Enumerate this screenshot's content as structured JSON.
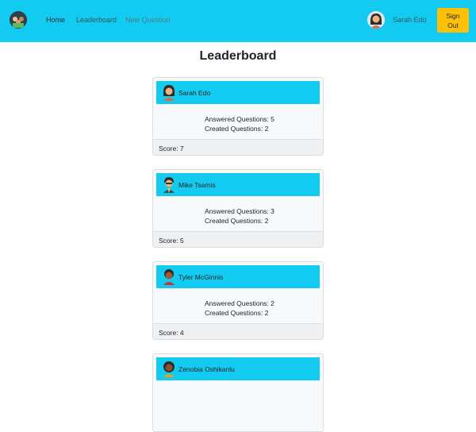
{
  "nav": {
    "home": "Home",
    "leaderboard": "Leaderboard",
    "new_question": "New Question",
    "user_name": "Sarah Edo",
    "sign_out": "Sign\nOut"
  },
  "page_title": "Leaderboard",
  "colors": {
    "navbar": "#13cbf0",
    "card_header": "#13cbf0",
    "sign_out": "#ffc107"
  },
  "users": [
    {
      "name": "Sarah Edo",
      "answered": "Answered Questions: 5",
      "created": "Created Questions: 2",
      "score": "Score: 7",
      "avatar": "woman-avatar-icon"
    },
    {
      "name": "Mike Tsamis",
      "answered": "Answered Questions: 3",
      "created": "Created Questions: 2",
      "score": "Score: 5",
      "avatar": "man-avatar-icon"
    },
    {
      "name": "Tyler McGinnis",
      "answered": "Answered Questions: 2",
      "created": "Created Questions: 2",
      "score": "Score: 4",
      "avatar": "man-avatar-icon"
    },
    {
      "name": "Zenobia Oshikanlu",
      "avatar": "woman-avatar-icon"
    }
  ]
}
